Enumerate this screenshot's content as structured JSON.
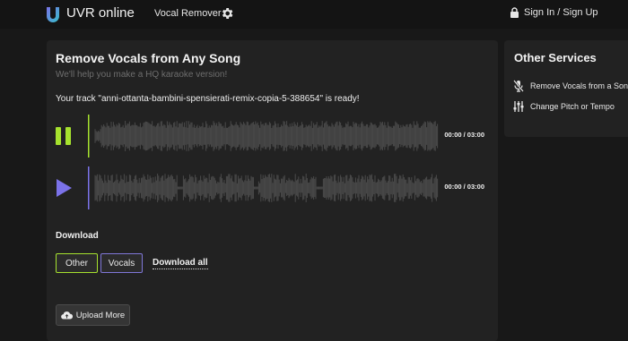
{
  "header": {
    "brand": "UVR online",
    "nav_vocal_remover": "Vocal Remover",
    "sign_in": "Sign In / Sign Up",
    "logo_icon": "uvr-logo",
    "settings_icon": "gear-icon",
    "lock_icon": "lock-icon"
  },
  "main": {
    "title": "Remove Vocals from Any Song",
    "subtitle": "We'll help you make a HQ karaoke version!",
    "ready_message": "Your track \"anni-ottanta-bambini-spensierati-remix-copia-5-388654\" is ready!",
    "tracks": [
      {
        "control": "pause",
        "time": "00:00 / 03:00",
        "accent": "#a6e22e",
        "progress": 0
      },
      {
        "control": "play",
        "time": "00:00 / 03:00",
        "accent": "#7b72e9",
        "progress": 0
      }
    ],
    "download_label": "Download",
    "download_buttons": {
      "other": "Other",
      "vocals": "Vocals",
      "all": "Download all"
    },
    "upload_more": "Upload More"
  },
  "side": {
    "title": "Other Services",
    "services": [
      {
        "label": "Remove Vocals from a Song",
        "icon": "mic-off-icon"
      },
      {
        "label": "Change Pitch or Tempo",
        "icon": "sliders-icon"
      }
    ]
  },
  "colors": {
    "background": "#181818",
    "panel": "#222222",
    "accent_green": "#a6e22e",
    "accent_purple": "#7b72e9",
    "waveform": "#4a4a4a"
  }
}
